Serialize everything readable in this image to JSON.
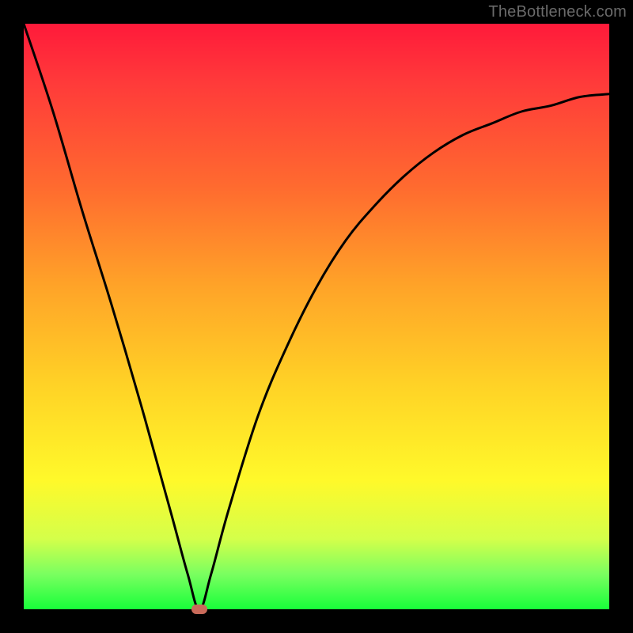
{
  "watermark": "TheBottleneck.com",
  "colors": {
    "frame": "#000000",
    "gradient_top": "#ff1a3a",
    "gradient_bottom": "#18ff3a",
    "curve": "#000000",
    "marker": "#c96a5a"
  },
  "chart_data": {
    "type": "line",
    "title": "",
    "xlabel": "",
    "ylabel": "",
    "xlim": [
      0,
      100
    ],
    "ylim": [
      0,
      100
    ],
    "marker": {
      "x": 30,
      "y": 0
    },
    "series": [
      {
        "name": "bottleneck-curve",
        "x": [
          0,
          5,
          10,
          15,
          20,
          25,
          28,
          30,
          32,
          35,
          40,
          45,
          50,
          55,
          60,
          65,
          70,
          75,
          80,
          85,
          90,
          95,
          100
        ],
        "y": [
          100,
          85,
          68,
          52,
          35,
          17,
          6,
          0,
          6,
          17,
          33,
          45,
          55,
          63,
          69,
          74,
          78,
          81,
          83,
          85,
          86,
          87.5,
          88
        ]
      }
    ]
  }
}
